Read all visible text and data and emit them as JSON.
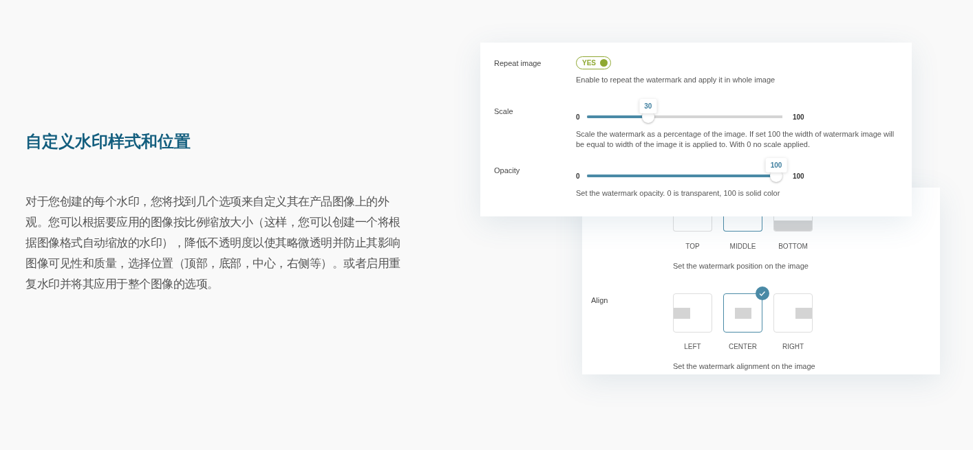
{
  "heading": "自定义水印样式和位置",
  "paragraph": "对于您创建的每个水印，您将找到几个选项来自定义其在产品图像上的外观。您可以根据要应用的图像按比例缩放大小（这样，您可以创建一个将根据图像格式自动缩放的水印），降低不透明度以使其略微透明并防止其影响图像可见性和质量，选择位置（顶部，底部，中心，右侧等）。或者启用重复水印并将其应用于整个图像的选项。",
  "settings_panel": {
    "rows": [
      {
        "kind": "toggle",
        "label": "Repeat image",
        "toggle_text": "YES",
        "on": true,
        "description": "Enable to repeat the watermark and apply it in whole image"
      },
      {
        "kind": "slider",
        "label": "Scale",
        "min": "0",
        "max": "100",
        "tooltip": "30",
        "level": 0.3,
        "description": "Scale the watermark as a percentage of the image. If set 100 the width of watermark image will be equal to width of the image it is applied to. With 0 no scale applied."
      },
      {
        "kind": "slider",
        "label": "Opacity",
        "min": "0",
        "max": "100",
        "tooltip": "100",
        "level": 1,
        "description": "Set the watermark opacity. 0 is transparent, 100 is solid color"
      }
    ]
  },
  "layout_panel": {
    "groups": [
      {
        "kind": "position",
        "options": [
          {
            "label": "TOP",
            "selected": false
          },
          {
            "label": "MIDDLE",
            "selected": true
          },
          {
            "label": "BOTTOM",
            "selected": false
          }
        ],
        "description": "Set the watermark position on the image"
      },
      {
        "kind": "align",
        "label": "Align",
        "options": [
          {
            "label": "LEFT",
            "selected": false
          },
          {
            "label": "CENTER",
            "selected": true
          },
          {
            "label": "RIGHT",
            "selected": false
          }
        ],
        "description": "Set the watermark alignment on the image"
      }
    ]
  }
}
